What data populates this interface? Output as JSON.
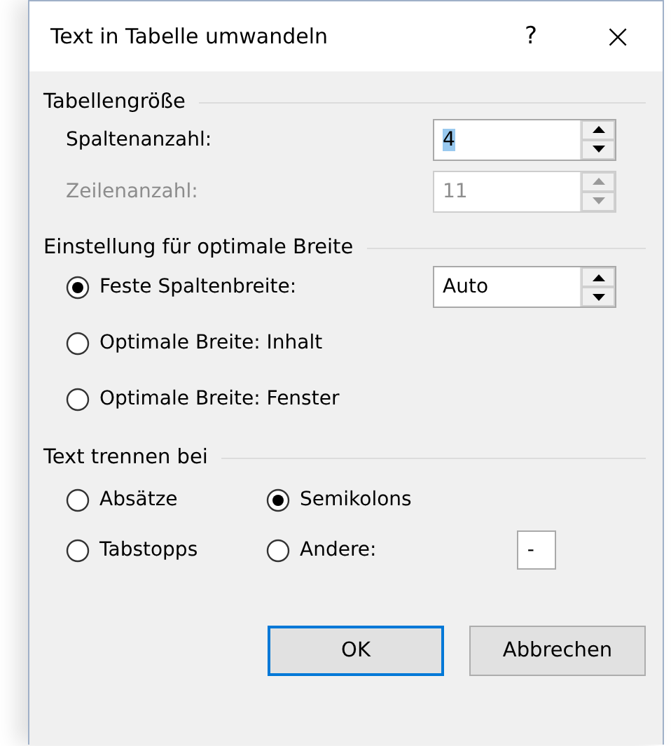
{
  "window": {
    "title": "Text in Tabelle umwandeln",
    "help_button": "?",
    "close_button": "×"
  },
  "table_size": {
    "title": "Tabellengröße",
    "fields": [
      {
        "label": "Spaltenanzahl:",
        "value": "4",
        "disabled": false,
        "text_selected": true
      },
      {
        "label": "Zeilenanzahl:",
        "value": "11",
        "disabled": true,
        "text_selected": false
      }
    ]
  },
  "autofit": {
    "title": "Einstellung für optimale Breite",
    "options": [
      {
        "label": "Feste Spaltenbreite:",
        "selected": true,
        "value": "Auto"
      },
      {
        "label": "Optimale Breite: Inhalt",
        "selected": false
      },
      {
        "label": "Optimale Breite: Fenster",
        "selected": false
      }
    ]
  },
  "separator": {
    "title": "Text trennen bei",
    "options": [
      {
        "label": "Absätze",
        "selected": false
      },
      {
        "label": "Semikolons",
        "selected": true
      },
      {
        "label": "Tabstopps",
        "selected": false
      },
      {
        "label": "Andere:",
        "selected": false,
        "value": "-"
      }
    ]
  },
  "buttons": [
    {
      "label": "OK",
      "default": true
    },
    {
      "label": "Abbrechen",
      "default": false
    }
  ]
}
